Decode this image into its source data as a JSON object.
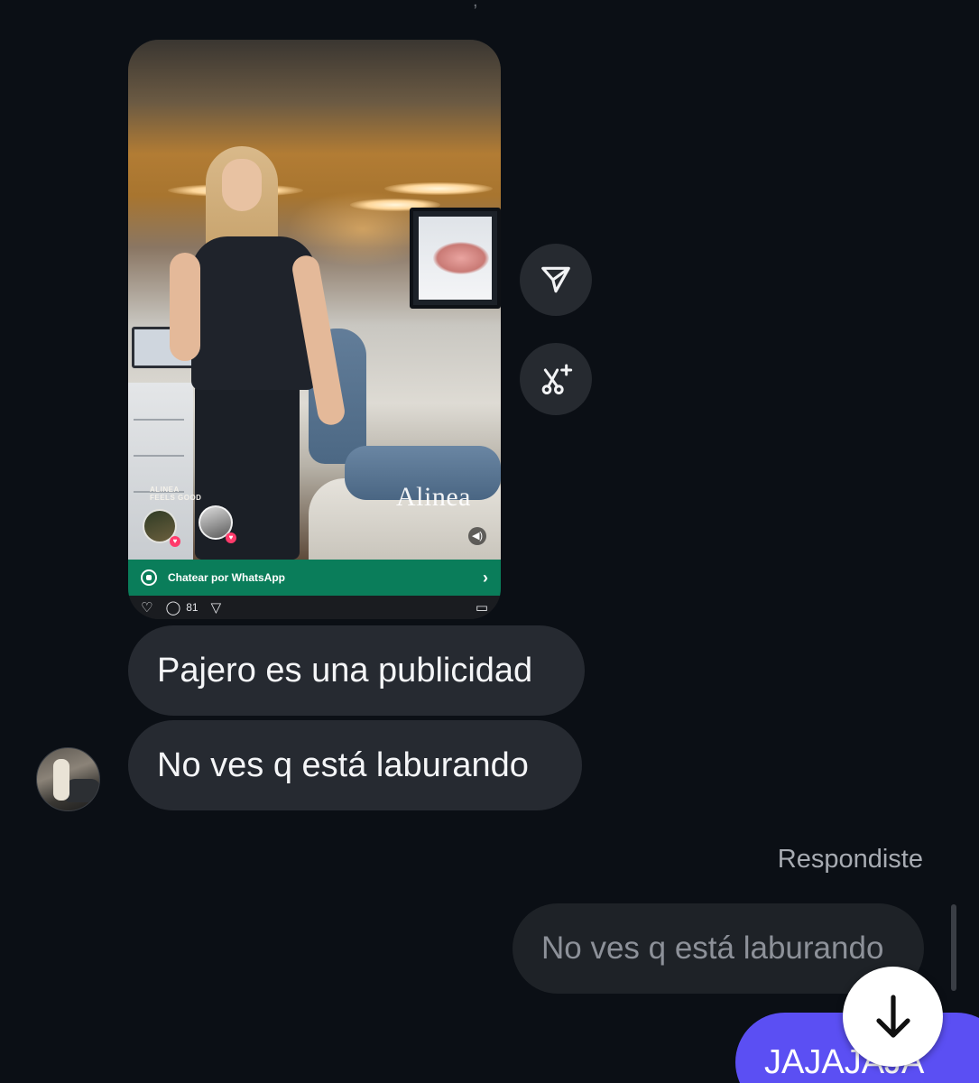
{
  "reel": {
    "brand_small": "ALINEA\nFEELS GOOD",
    "brand_logo": "Alinea",
    "cta_label": "Chatear por WhatsApp",
    "comment_count": "81"
  },
  "messages": {
    "received_1": "Pajero es una publicidad",
    "received_2": "No ves q está laburando",
    "reply_label": "Respondiste",
    "quoted_text": "No ves q está laburando",
    "sent_text": "JAJAJAJA"
  },
  "icons": {
    "share": "send-icon",
    "ai": "ai-sparkle-icon",
    "scroll_down": "arrow-down-icon",
    "whatsapp": "whatsapp-icon",
    "volume": "volume-icon"
  },
  "colors": {
    "background": "#0b0f15",
    "received_bubble": "#262a31",
    "sent_bubble": "#5b4ff3",
    "whatsapp_bar": "#0a7d5a"
  }
}
